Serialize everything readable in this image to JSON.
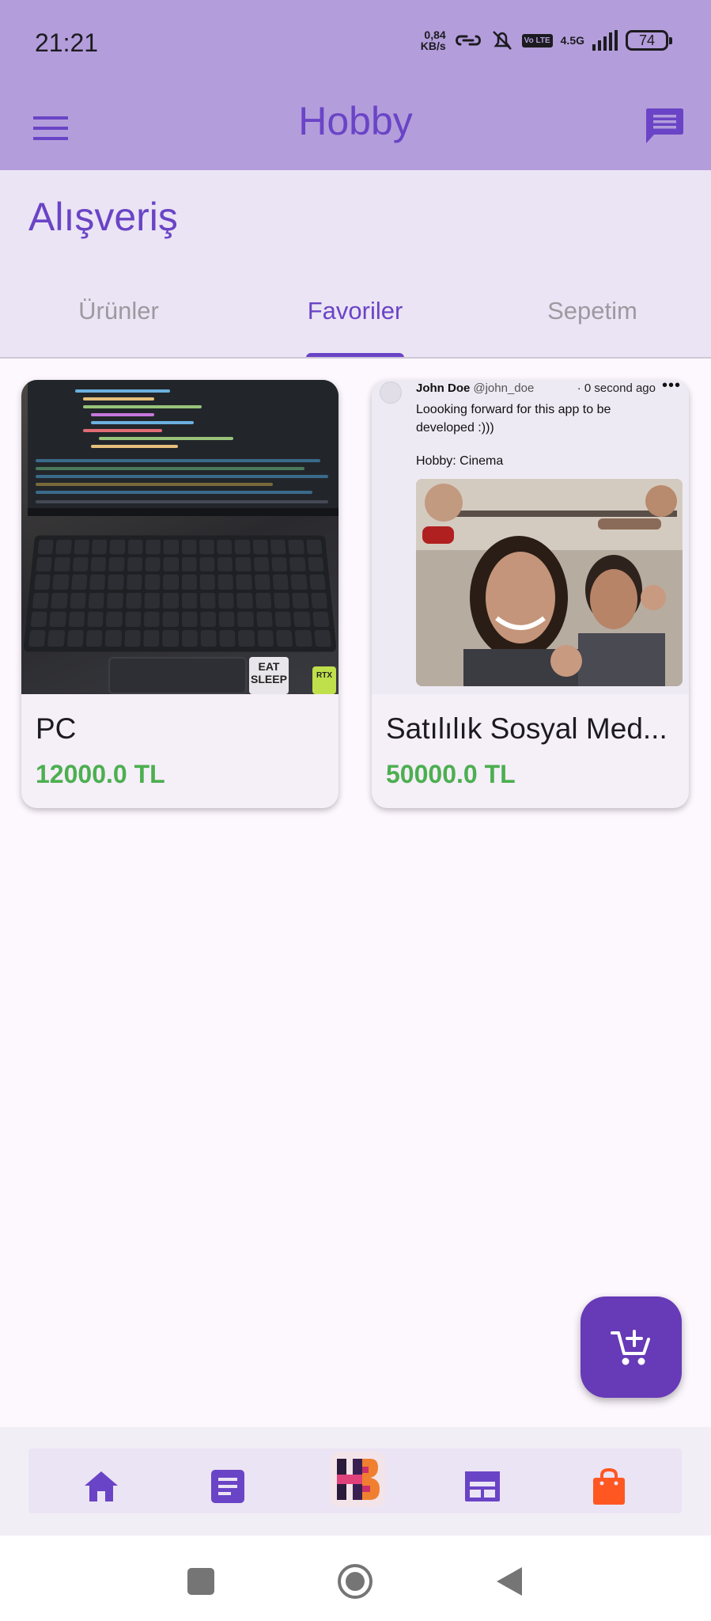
{
  "status_bar": {
    "time": "21:21",
    "net_speed_value": "0,84",
    "net_speed_unit": "KB/s",
    "volte": "Vo LTE",
    "network_type": "4.5G",
    "battery": "74"
  },
  "app_bar": {
    "title": "Hobby",
    "menu_icon": "hamburger-menu-icon",
    "chat_icon": "chat-icon"
  },
  "page": {
    "section_title": "Alışveriş",
    "tabs": [
      {
        "label": "Ürünler",
        "active": false
      },
      {
        "label": "Favoriler",
        "active": true
      },
      {
        "label": "Sepetim",
        "active": false
      }
    ]
  },
  "products": [
    {
      "title": "PC",
      "price": "12000.0 TL",
      "image_stickers": [
        "EAT SLEEP",
        "RTX"
      ]
    },
    {
      "title": "Satılılık Sosyal Med...",
      "price": "50000.0 TL",
      "post": {
        "author": "John Doe",
        "handle": "@john_doe",
        "time": "· 0 second ago",
        "menu": "•••",
        "text": "Loooking forward for this app to be developed :)))",
        "hobby": "Hobby: Cinema"
      }
    }
  ],
  "fab": {
    "icon": "add-to-cart-icon"
  },
  "bottom_nav": {
    "items": [
      {
        "icon": "home-icon"
      },
      {
        "icon": "article-icon"
      },
      {
        "icon": "hobby-logo-icon"
      },
      {
        "icon": "calendar-view-icon"
      },
      {
        "icon": "shopping-bag-icon"
      }
    ]
  },
  "system_nav": {
    "items": [
      {
        "icon": "recents-square-icon"
      },
      {
        "icon": "home-circle-icon"
      },
      {
        "icon": "back-triangle-icon"
      }
    ]
  },
  "colors": {
    "app_bar": "#b39ddb",
    "primary": "#6a44c6",
    "price": "#4caf50",
    "fab": "#673ab7",
    "cart_bag": "#ff5722"
  }
}
